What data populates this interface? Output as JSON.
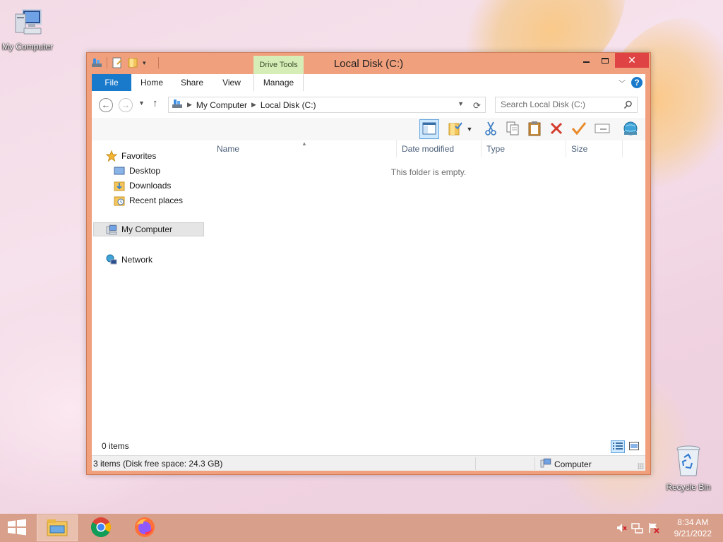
{
  "desktop": {
    "icons": [
      {
        "label": "My Computer",
        "icon": "computer-icon"
      },
      {
        "label": "Recycle Bin",
        "icon": "recycle-bin-icon"
      }
    ]
  },
  "window": {
    "title": "Local Disk (C:)",
    "context_tab_group": "Drive Tools",
    "tabs": [
      {
        "label": "File"
      },
      {
        "label": "Home"
      },
      {
        "label": "Share"
      },
      {
        "label": "View"
      },
      {
        "label": "Manage"
      }
    ],
    "controls": {
      "minimize": "minimize-icon",
      "maximize": "maximize-icon",
      "close": "close-icon"
    }
  },
  "address": {
    "crumbs": [
      "My Computer",
      "Local Disk (C:)"
    ],
    "search_placeholder": "Search Local Disk (C:)"
  },
  "sidebar": {
    "favorites_label": "Favorites",
    "favorites": [
      {
        "label": "Desktop"
      },
      {
        "label": "Downloads"
      },
      {
        "label": "Recent places"
      }
    ],
    "my_computer": "My Computer",
    "network": "Network"
  },
  "list": {
    "columns": [
      "Name",
      "Date modified",
      "Type",
      "Size"
    ],
    "empty_text": "This folder is empty.",
    "item_count": "0 items"
  },
  "status": {
    "left": "3 items (Disk free space: 24.3 GB)",
    "right": "Computer"
  },
  "taskbar": {
    "apps": [
      "file-explorer-icon",
      "chrome-icon",
      "firefox-icon"
    ],
    "time": "8:34 AM",
    "date": "9/21/2022"
  },
  "colors": {
    "window_frame": "#f0a07d",
    "file_tab": "#1979ca",
    "drive_tools": "#d7edb8",
    "close_button": "#e04343",
    "taskbar": "#d89f8a"
  }
}
